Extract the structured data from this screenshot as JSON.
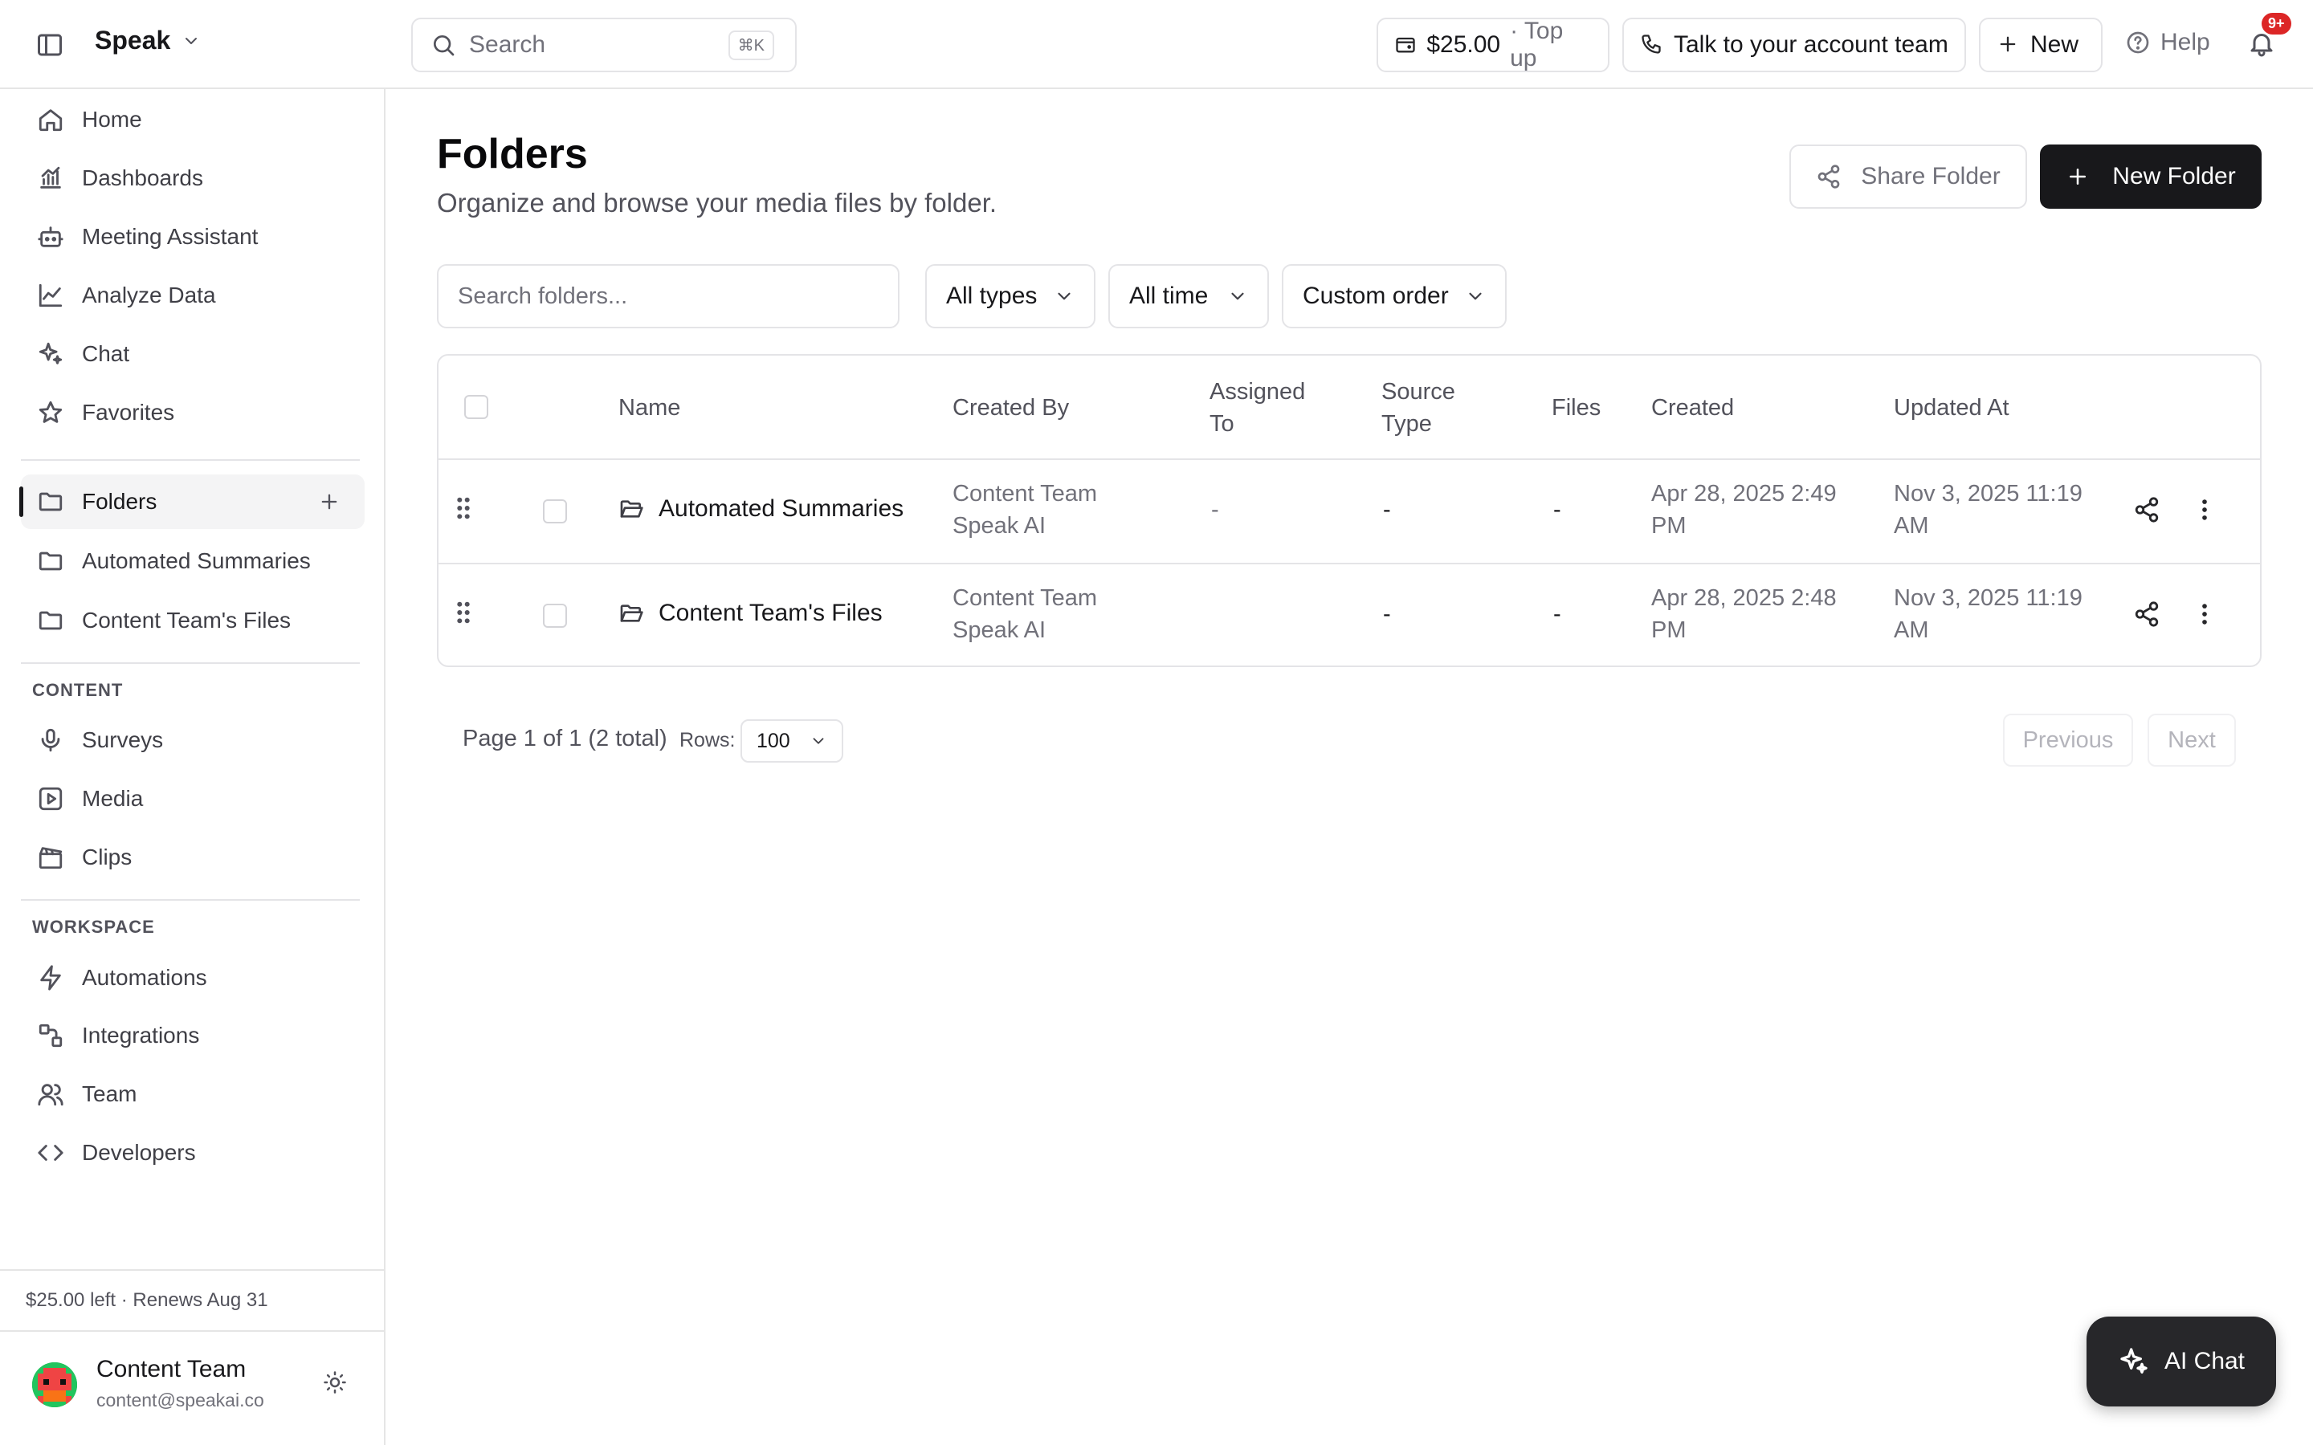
{
  "app": {
    "name": "Speak"
  },
  "header": {
    "search_placeholder": "Search",
    "search_shortcut": "⌘K",
    "balance": "$25.00",
    "topup": "· Top up",
    "talk_label": "Talk to your account team",
    "new_label": "New",
    "help_label": "Help",
    "notifications_badge": "9+"
  },
  "sidebar": {
    "primary": [
      {
        "label": "Home",
        "icon": "home-icon"
      },
      {
        "label": "Dashboards",
        "icon": "chart-icon"
      },
      {
        "label": "Meeting Assistant",
        "icon": "bot-icon"
      },
      {
        "label": "Analyze Data",
        "icon": "line-chart-icon"
      },
      {
        "label": "Chat",
        "icon": "sparkles-icon"
      },
      {
        "label": "Favorites",
        "icon": "star-icon"
      }
    ],
    "folders": [
      {
        "label": "Folders",
        "icon": "folder-icon",
        "active": true
      },
      {
        "label": "Automated Summaries",
        "icon": "folder-icon"
      },
      {
        "label": "Content Team's Files",
        "icon": "folder-icon"
      }
    ],
    "content_heading": "CONTENT",
    "content": [
      {
        "label": "Surveys",
        "icon": "microphone-icon"
      },
      {
        "label": "Media",
        "icon": "play-icon"
      },
      {
        "label": "Clips",
        "icon": "clapperboard-icon"
      }
    ],
    "workspace_heading": "WORKSPACE",
    "workspace": [
      {
        "label": "Automations",
        "icon": "bolt-icon"
      },
      {
        "label": "Integrations",
        "icon": "integrations-icon"
      },
      {
        "label": "Team",
        "icon": "team-icon"
      },
      {
        "label": "Developers",
        "icon": "code-icon"
      }
    ],
    "credits": "$25.00 left · Renews Aug 31",
    "user": {
      "name": "Content Team",
      "email": "content@speakai.co"
    }
  },
  "main": {
    "title": "Folders",
    "subtitle": "Organize and browse your media files by folder.",
    "share_folder_label": "Share Folder",
    "new_folder_label": "New Folder",
    "search_placeholder": "Search folders...",
    "filters": {
      "type": "All types",
      "time": "All time",
      "order": "Custom order"
    },
    "columns": {
      "name": "Name",
      "created_by": "Created By",
      "assigned_to_1": "Assigned",
      "assigned_to_2": "To",
      "source_type_1": "Source",
      "source_type_2": "Type",
      "files": "Files",
      "created": "Created",
      "updated_at": "Updated At"
    },
    "rows": [
      {
        "name": "Automated Summaries",
        "created_by_1": "Content Team",
        "created_by_2": "Speak AI",
        "assigned_to": "-",
        "source_type": "-",
        "files": "-",
        "created_1": "Apr 28, 2025 2:49",
        "created_2": "PM",
        "updated_1": "Nov 3, 2025 11:19",
        "updated_2": "AM"
      },
      {
        "name": "Content Team's Files",
        "created_by_1": "Content Team",
        "created_by_2": "Speak AI",
        "assigned_to": "",
        "source_type": "-",
        "files": "-",
        "created_1": "Apr 28, 2025 2:48",
        "created_2": "PM",
        "updated_1": "Nov 3, 2025 11:19",
        "updated_2": "AM"
      }
    ],
    "pagination": {
      "summary": "Page 1 of 1 (2 total)",
      "rows_label": "Rows:",
      "rows_value": "100",
      "previous": "Previous",
      "next": "Next"
    },
    "ai_chat_label": "AI Chat"
  }
}
